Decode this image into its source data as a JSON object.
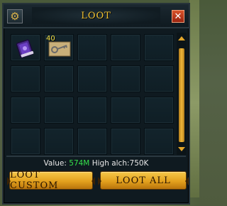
{
  "window": {
    "title": "LOOT",
    "settings_icon": "cog-icon",
    "close_icon": "close-icon"
  },
  "slots": [
    {
      "item": "purple-book-icon",
      "quantity": ""
    },
    {
      "item": "key-icon",
      "quantity": "40"
    },
    {
      "item": "",
      "quantity": ""
    },
    {
      "item": "",
      "quantity": ""
    },
    {
      "item": "",
      "quantity": ""
    },
    {
      "item": "",
      "quantity": ""
    },
    {
      "item": "",
      "quantity": ""
    },
    {
      "item": "",
      "quantity": ""
    },
    {
      "item": "",
      "quantity": ""
    },
    {
      "item": "",
      "quantity": ""
    },
    {
      "item": "",
      "quantity": ""
    },
    {
      "item": "",
      "quantity": ""
    },
    {
      "item": "",
      "quantity": ""
    },
    {
      "item": "",
      "quantity": ""
    },
    {
      "item": "",
      "quantity": ""
    },
    {
      "item": "",
      "quantity": ""
    },
    {
      "item": "",
      "quantity": ""
    },
    {
      "item": "",
      "quantity": ""
    },
    {
      "item": "",
      "quantity": ""
    },
    {
      "item": "",
      "quantity": ""
    }
  ],
  "summary": {
    "value_label": "Value:",
    "value": "574M",
    "high_alch_label": "High alch:",
    "high_alch_value": "750K"
  },
  "buttons": {
    "loot_custom": "LOOT CUSTOM",
    "loot_all": "LOOT ALL"
  },
  "colors": {
    "title": "#f1c232",
    "value_green": "#35e04a",
    "button_gold": "#e3a11e"
  }
}
